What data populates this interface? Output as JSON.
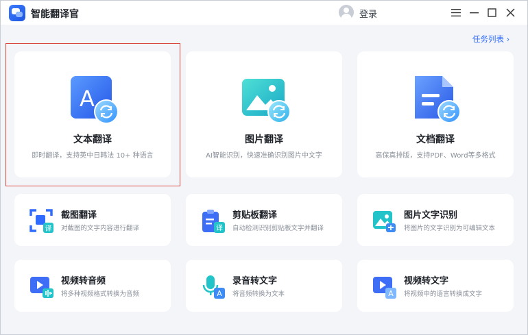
{
  "app": {
    "title": "智能翻译官",
    "login_label": "登录"
  },
  "task_link": {
    "label": "任务列表 ›"
  },
  "big_cards": [
    {
      "title": "文本翻译",
      "desc": "即时翻译，支持英中日韩法 10+ 种语言",
      "icon": "text-translate-icon",
      "icon_letter": "A"
    },
    {
      "title": "图片翻译",
      "desc": "AI智能识别，快速准确识别图片中文字",
      "icon": "image-translate-icon"
    },
    {
      "title": "文档翻译",
      "desc": "高保真排版，支持PDF、Word等多格式",
      "icon": "document-translate-icon"
    }
  ],
  "small_cards": [
    {
      "title": "截图翻译",
      "desc": "对截图的文字内容进行翻译",
      "icon": "screenshot-translate-icon",
      "badge": "译"
    },
    {
      "title": "剪贴板翻译",
      "desc": "自动检测识别剪贴板文字并翻译",
      "icon": "clipboard-translate-icon",
      "badge": "译"
    },
    {
      "title": "图片文字识别",
      "desc": "将图片的文字识别为可编辑文本",
      "icon": "image-ocr-icon"
    },
    {
      "title": "视频转音频",
      "desc": "将多种视频格式转换为音频",
      "icon": "video-to-audio-icon"
    },
    {
      "title": "录音转文字",
      "desc": "将音频转换为文本",
      "icon": "audio-to-text-icon",
      "badge": "A"
    },
    {
      "title": "视频转文字",
      "desc": "将视频中的语言转换成文字",
      "icon": "video-to-text-icon",
      "badge": "A"
    }
  ],
  "colors": {
    "accent": "#2f6bff",
    "selection_outline": "#d9473f",
    "teal": "#22c3c9"
  }
}
